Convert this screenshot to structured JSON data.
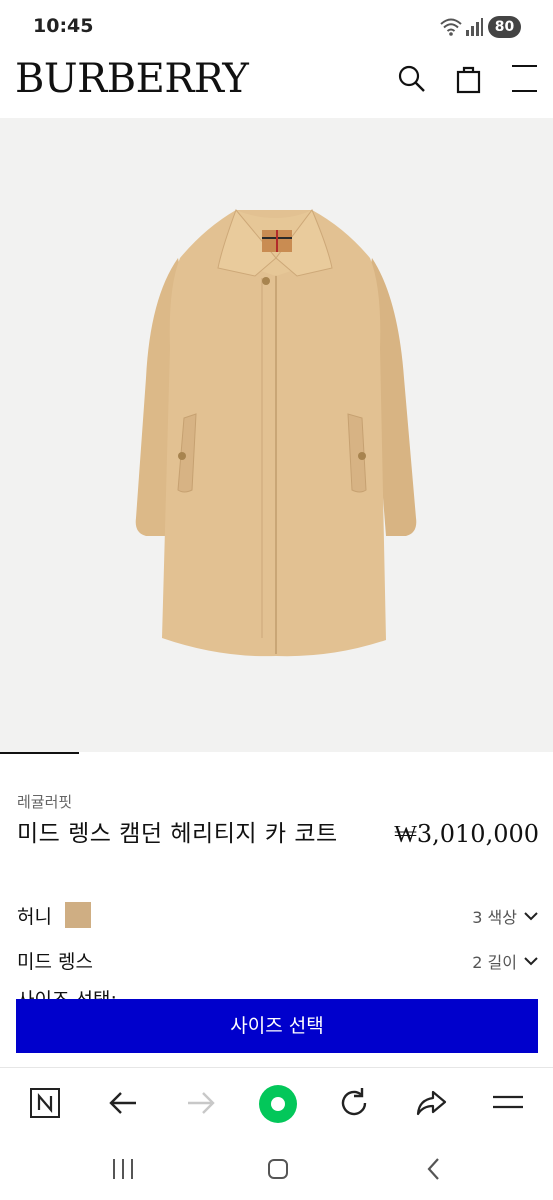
{
  "status": {
    "time": "10:45",
    "battery": "80"
  },
  "header": {
    "brand": "BURBERRY",
    "icons": [
      "search-icon",
      "shopping-bag-icon",
      "menu-icon"
    ]
  },
  "product": {
    "fit": "레귤러핏",
    "title": "미드 렝스 캠던 헤리티지 카 코트",
    "price": "₩3,010,000",
    "color_name": "허니",
    "color_hex": "#cfae83",
    "color_count": "3 색상",
    "length_name": "미드 렝스",
    "length_count": "2 길이",
    "partial_text": "사이즈 선택:",
    "size_button": "사이즈 선택"
  },
  "browser": {
    "icons": [
      "naver-icon",
      "back-arrow-icon",
      "forward-arrow-icon",
      "green-dot-icon",
      "reload-icon",
      "share-icon",
      "menu-icon"
    ]
  },
  "system_nav": {
    "icons": [
      "recents-icon",
      "home-icon",
      "back-icon"
    ]
  },
  "colors": {
    "accent_button": "#0000cc",
    "coat": "#e1c090",
    "background_image": "#f2f2f1"
  }
}
